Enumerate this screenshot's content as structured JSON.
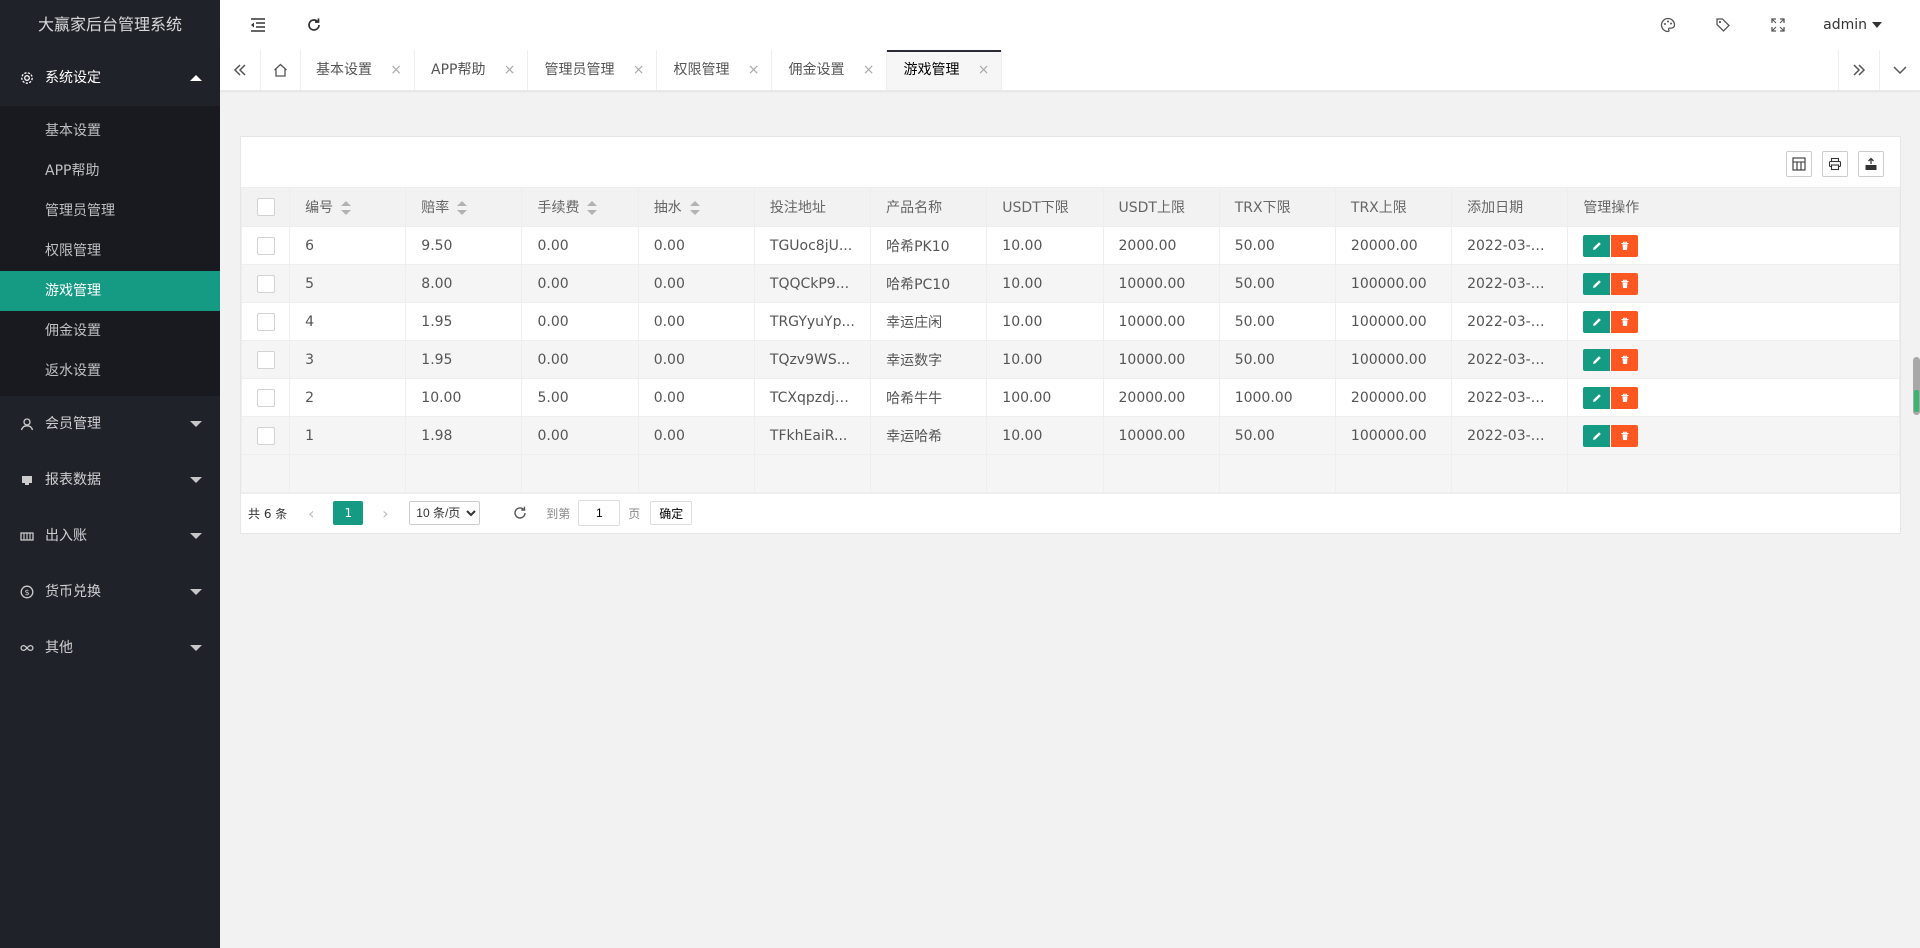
{
  "app": {
    "title": "大赢家后台管理系统"
  },
  "sidebar": {
    "groups": [
      {
        "label": "系统设定",
        "icon": "gear-icon",
        "open": true,
        "items": [
          {
            "label": "基本设置",
            "active": false
          },
          {
            "label": "APP帮助",
            "active": false
          },
          {
            "label": "管理员管理",
            "active": false
          },
          {
            "label": "权限管理",
            "active": false
          },
          {
            "label": "游戏管理",
            "active": true
          },
          {
            "label": "佣金设置",
            "active": false
          },
          {
            "label": "返水设置",
            "active": false
          }
        ]
      },
      {
        "label": "会员管理",
        "icon": "user-icon",
        "open": false
      },
      {
        "label": "报表数据",
        "icon": "report-icon",
        "open": false
      },
      {
        "label": "出入账",
        "icon": "account-icon",
        "open": false
      },
      {
        "label": "货币兑换",
        "icon": "currency-icon",
        "open": false
      },
      {
        "label": "其他",
        "icon": "infinity-icon",
        "open": false
      }
    ]
  },
  "header": {
    "user": "admin"
  },
  "tabs": [
    {
      "label": "基本设置",
      "active": false
    },
    {
      "label": "APP帮助",
      "active": false
    },
    {
      "label": "管理员管理",
      "active": false
    },
    {
      "label": "权限管理",
      "active": false
    },
    {
      "label": "佣金设置",
      "active": false
    },
    {
      "label": "游戏管理",
      "active": true
    }
  ],
  "table": {
    "columns": [
      "编号",
      "赔率",
      "手续费",
      "抽水",
      "投注地址",
      "产品名称",
      "USDT下限",
      "USDT上限",
      "TRX下限",
      "TRX上限",
      "添加日期",
      "管理操作"
    ],
    "rows": [
      [
        "6",
        "9.50",
        "0.00",
        "0.00",
        "TGUoc8jU...",
        "哈希PK10",
        "10.00",
        "2000.00",
        "50.00",
        "20000.00",
        "2022-03-2..."
      ],
      [
        "5",
        "8.00",
        "0.00",
        "0.00",
        "TQQCkP9...",
        "哈希PC10",
        "10.00",
        "10000.00",
        "50.00",
        "100000.00",
        "2022-03-2..."
      ],
      [
        "4",
        "1.95",
        "0.00",
        "0.00",
        "TRGYyuYp...",
        "幸运庄闲",
        "10.00",
        "10000.00",
        "50.00",
        "100000.00",
        "2022-03-2..."
      ],
      [
        "3",
        "1.95",
        "0.00",
        "0.00",
        "TQzv9WS...",
        "幸运数字",
        "10.00",
        "10000.00",
        "50.00",
        "100000.00",
        "2022-03-2..."
      ],
      [
        "2",
        "10.00",
        "5.00",
        "0.00",
        "TCXqpzdjn...",
        "哈希牛牛",
        "100.00",
        "20000.00",
        "1000.00",
        "200000.00",
        "2022-03-2..."
      ],
      [
        "1",
        "1.98",
        "0.00",
        "0.00",
        "TFkhEaiR...",
        "幸运哈希",
        "10.00",
        "10000.00",
        "50.00",
        "100000.00",
        "2022-03-2..."
      ]
    ]
  },
  "pager": {
    "count": "共 6 条",
    "current": "1",
    "page_size": "10 条/页",
    "goto_label": "到第",
    "goto_value": "1",
    "page_unit": "页",
    "confirm": "确定"
  },
  "colors": {
    "sidebar_bg": "#20222a",
    "accent": "#159a83",
    "danger": "#ff5722"
  }
}
